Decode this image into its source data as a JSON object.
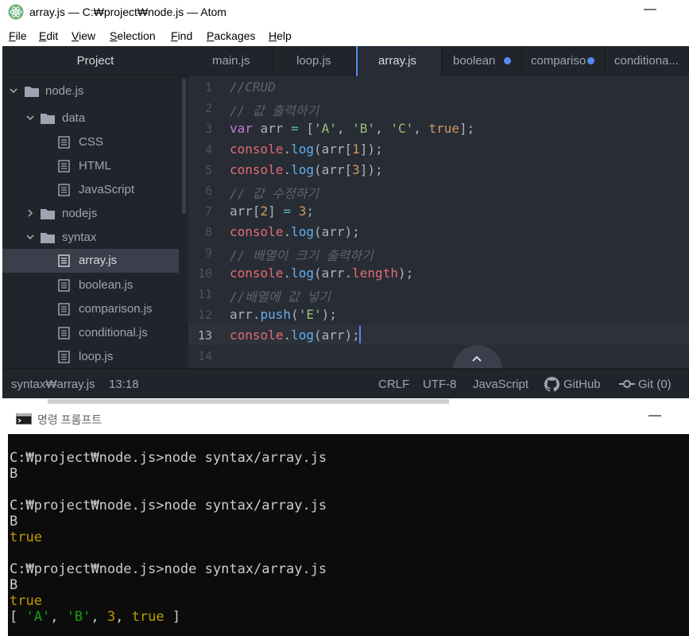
{
  "atom": {
    "window_title": "array.js — C:₩project₩node.js — Atom",
    "minimize_glyph": "—",
    "menu": [
      {
        "key": "F",
        "rest": "ile"
      },
      {
        "key": "E",
        "rest": "dit"
      },
      {
        "key": "V",
        "rest": "iew"
      },
      {
        "key": "S",
        "rest": "election"
      },
      {
        "key": "F",
        "rest": "ind"
      },
      {
        "key": "P",
        "rest": "ackages"
      },
      {
        "key": "H",
        "rest": "elp"
      }
    ],
    "sidebar": {
      "title": "Project",
      "tree": [
        {
          "label": "node.js"
        },
        {
          "label": "data"
        },
        {
          "label": "CSS"
        },
        {
          "label": "HTML"
        },
        {
          "label": "JavaScript"
        },
        {
          "label": "nodejs"
        },
        {
          "label": "syntax"
        },
        {
          "label": "array.js"
        },
        {
          "label": "boolean.js"
        },
        {
          "label": "comparison.js"
        },
        {
          "label": "conditional.js"
        },
        {
          "label": "loop.js"
        }
      ]
    },
    "tabs": [
      {
        "label": "main.js"
      },
      {
        "label": "loop.js"
      },
      {
        "label": "array.js"
      },
      {
        "label": "boolean"
      },
      {
        "label": "compariso"
      },
      {
        "label": "conditiona..."
      }
    ],
    "editor": {
      "line_numbers": [
        "1",
        "2",
        "3",
        "4",
        "5",
        "6",
        "7",
        "8",
        "9",
        "10",
        "11",
        "12",
        "13",
        "14"
      ],
      "lines": {
        "l1_comment": "//CRUD",
        "l2_comment": "// 값 출력하기",
        "l3_var": "var",
        "l3_name": " arr ",
        "l3_eq": "=",
        "l3_open": " [",
        "l3_a": "'A'",
        "l3_c1": ", ",
        "l3_b": "'B'",
        "l3_c2": ", ",
        "l3_c": "'C'",
        "l3_c3": ", ",
        "l3_true": "true",
        "l3_close": "];",
        "console": "console",
        "dot": ".",
        "log": "log",
        "l4_args_open": "(arr[",
        "l4_idx": "1",
        "l4_args_close": "]);",
        "l5_args_open": "(arr[",
        "l5_idx": "3",
        "l5_args_close": "]);",
        "l6_comment": "// 값 수정하기",
        "l7_lhs": "arr[",
        "l7_idx": "2",
        "l7_mid": "] ",
        "l7_eq": "=",
        "l7_sp": " ",
        "l7_val": "3",
        "l7_end": ";",
        "l8_args": "(arr);",
        "l9_comment": "// 배열이 크기 출력하기",
        "l10_open": "(arr.",
        "l10_prop": "length",
        "l10_close": ");",
        "l11_comment": "//배열에 값 넣기",
        "l12_obj": "arr.",
        "l12_fn": "push",
        "l12_open": "(",
        "l12_str": "'E'",
        "l12_close": ");",
        "l13_args": "(arr);"
      }
    },
    "status": {
      "path": "syntax₩array.js",
      "position": "13:18",
      "line_ending": "CRLF",
      "encoding": "UTF-8",
      "grammar": "JavaScript",
      "github": "GitHub",
      "git": "Git (0)"
    }
  },
  "cmd": {
    "window_title": "명령 프롬프트",
    "minimize_glyph": "—",
    "lines": {
      "p1": "C:₩project₩node.js>node syntax/array.js",
      "o1": "B",
      "p2": "C:₩project₩node.js>node syntax/array.js",
      "o2": "B",
      "o2b": "true",
      "p3": "C:₩project₩node.js>node syntax/array.js",
      "o3": "B",
      "o3b": "true",
      "arr_open": "[ ",
      "arr_a": "'A'",
      "arr_c1": ", ",
      "arr_b": "'B'",
      "arr_c2": ", ",
      "arr_3": "3",
      "arr_c3": ", ",
      "arr_true": "true",
      "arr_close": " ]"
    }
  },
  "colors": {
    "editor_bg": "#282c34",
    "panel_bg": "#21252b",
    "accent": "#568af2",
    "console_bg": "#0c0c0c",
    "console_yellow": "#c19c00",
    "console_green": "#13a10e"
  }
}
